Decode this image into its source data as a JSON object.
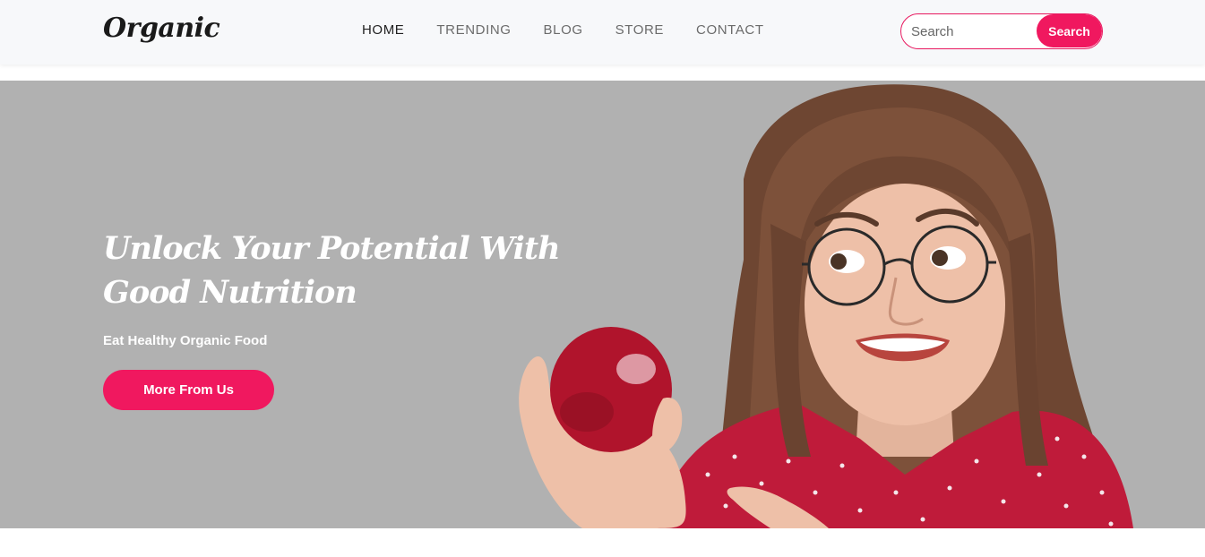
{
  "header": {
    "logo": "Organic",
    "nav": [
      {
        "label": "HOME",
        "active": true
      },
      {
        "label": "TRENDING",
        "active": false
      },
      {
        "label": "BLOG",
        "active": false
      },
      {
        "label": "STORE",
        "active": false
      },
      {
        "label": "CONTACT",
        "active": false
      }
    ],
    "search": {
      "placeholder": "Search",
      "value": "",
      "button_label": "Search"
    }
  },
  "hero": {
    "title": "Unlock Your Potential With Good Nutrition",
    "subtitle": "Eat Healthy Organic Food",
    "cta_label": "More From Us"
  },
  "colors": {
    "accent": "#f0185f",
    "hero_background": "#b1b1b1",
    "header_background": "#f7f8fa"
  }
}
